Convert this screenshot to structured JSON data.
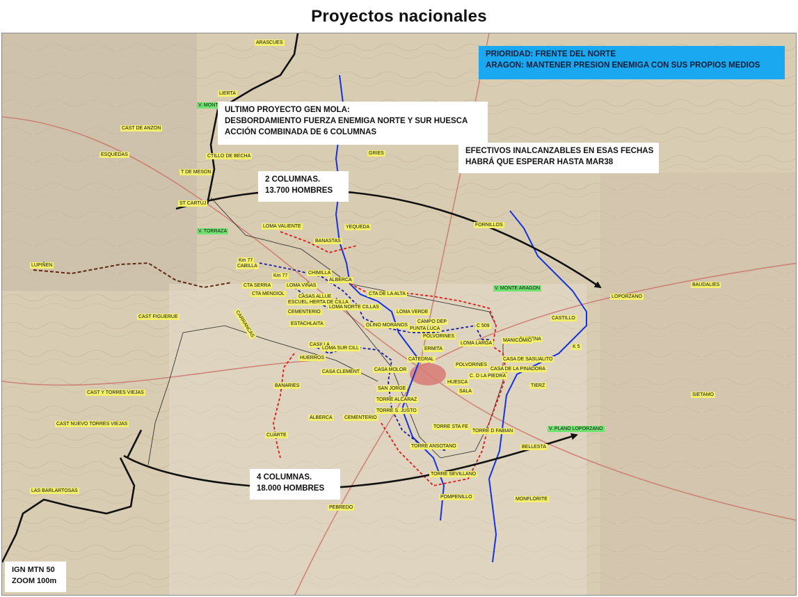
{
  "title": "Proyectos nacionales",
  "colors": {
    "map_base": "#d8ccb3",
    "front_line": "#111111",
    "river": "#1432e0",
    "red_dash": "#e01818",
    "blue_dash": "#1a1aa0",
    "brown_dash": "#5a2a10",
    "label_yellow": "#f4f06a",
    "label_green": "#72e372",
    "priority_box": "#1aa8f0"
  },
  "boxes": {
    "priority": [
      "PRIORIDAD: FRENTE DEL NORTE",
      "ARAGON: MANTENER PRESION ENEMIGA CON SUS PROPIOS MEDIOS"
    ],
    "mola": [
      "ULTIMO PROYECTO GEN MOLA:",
      "DESBORDAMIENTO FUERZA ENEMIGA NORTE Y SUR HUESCA",
      "ACCIÓN COMBINADA DE 6 COLUMNAS"
    ],
    "efectivos": [
      "EFECTIVOS INALCANZABLES EN ESAS FECHAS",
      "HABRÁ QUE ESPERAR HASTA MAR38"
    ],
    "col2": [
      "2 COLUMNAS.",
      "13.700 HOMBRES"
    ],
    "col4": [
      "4 COLUMNAS.",
      "18.000 HOMBRES"
    ],
    "source": [
      "IGN MTN 50",
      "ZOOM 100m"
    ]
  },
  "places": [
    {
      "t": "ARASCUES",
      "c": "y"
    },
    {
      "t": "LIERTA",
      "c": "y"
    },
    {
      "t": "V. MONT",
      "c": "g"
    },
    {
      "t": "CAST DE ANZON",
      "c": "y"
    },
    {
      "t": "ESQUEDAS",
      "c": "y"
    },
    {
      "t": "CTILLO DE BECHA",
      "c": "y"
    },
    {
      "t": "T DE MESON",
      "c": "y"
    },
    {
      "t": "ST CARTUJ",
      "c": "y"
    },
    {
      "t": "V. TORRAZA",
      "c": "g"
    },
    {
      "t": "LOMA VALIENTE",
      "c": "y"
    },
    {
      "t": "BANASTAS",
      "c": "y"
    },
    {
      "t": "YEQUEDA",
      "c": "y"
    },
    {
      "t": "GRIES",
      "c": "y"
    },
    {
      "t": "FORNILLOS",
      "c": "y"
    },
    {
      "t": "LUPIÑEN",
      "c": "y"
    },
    {
      "t": "Km 77",
      "c": "y"
    },
    {
      "t": "CABILLA",
      "c": "y"
    },
    {
      "t": "Km 77",
      "c": "y"
    },
    {
      "t": "CHIMILLA",
      "c": "y"
    },
    {
      "t": "ALBERCA",
      "c": "y"
    },
    {
      "t": "LOMA VIÑAS",
      "c": "y"
    },
    {
      "t": "CTA SERRA",
      "c": "y"
    },
    {
      "t": "CTA MENDIOL",
      "c": "y"
    },
    {
      "t": "CASAS ALLUE",
      "c": "y"
    },
    {
      "t": "ESCUELA",
      "c": "y"
    },
    {
      "t": "HERTA DE CILLA",
      "c": "y"
    },
    {
      "t": "LOMA NORTE CILLAS",
      "c": "y"
    },
    {
      "t": "CTA DE LA ALTA",
      "c": "y"
    },
    {
      "t": "V. MONTE ARAGON",
      "c": "g"
    },
    {
      "t": "LOPORZANO",
      "c": "y"
    },
    {
      "t": "BAUDALIES",
      "c": "y"
    },
    {
      "t": "CAST FIGUERUE",
      "c": "y"
    },
    {
      "t": "CEMENTERIO",
      "c": "y"
    },
    {
      "t": "ESTACHLAITA",
      "c": "y"
    },
    {
      "t": "LOMA VERDE",
      "c": "y"
    },
    {
      "t": "CAMPO DEP",
      "c": "y"
    },
    {
      "t": "OLINO MORANOS",
      "c": "y"
    },
    {
      "t": "PUNTA LUCA",
      "c": "y"
    },
    {
      "t": "C 509",
      "c": "y"
    },
    {
      "t": "CASTILLO",
      "c": "y"
    },
    {
      "t": "POLVORINES",
      "c": "y"
    },
    {
      "t": "QUICENA",
      "c": "y"
    },
    {
      "t": "K 5",
      "c": "y"
    },
    {
      "t": "LOMA LARGA",
      "c": "y"
    },
    {
      "t": "MANICOMIO",
      "c": "y"
    },
    {
      "t": "ERMITA",
      "c": "y"
    },
    {
      "t": "CASILLA",
      "c": "y"
    },
    {
      "t": "LOMA SUR CILL",
      "c": "y"
    },
    {
      "t": "HUERROS",
      "c": "y"
    },
    {
      "t": "CATEDRAL",
      "c": "y"
    },
    {
      "t": "CASA DE SASUALITO",
      "c": "y"
    },
    {
      "t": "POLVORINES",
      "c": "y"
    },
    {
      "t": "CASA DE LA PINADORA",
      "c": "y"
    },
    {
      "t": "C. D LA PIEDRA",
      "c": "y"
    },
    {
      "t": "CASA CLEMENT",
      "c": "y"
    },
    {
      "t": "CASA MOLOR",
      "c": "y"
    },
    {
      "t": "HUESCA",
      "c": "y"
    },
    {
      "t": "SALA",
      "c": "y"
    },
    {
      "t": "BANARIES",
      "c": "y"
    },
    {
      "t": "SAN JORGE",
      "c": "y"
    },
    {
      "t": "TORRE ALCARAZ",
      "c": "y"
    },
    {
      "t": "TORRE S. JUSTO",
      "c": "y"
    },
    {
      "t": "TIERZ",
      "c": "y"
    },
    {
      "t": "SIETAMO",
      "c": "y"
    },
    {
      "t": "CAST Y TORRES VIEJAS",
      "c": "y"
    },
    {
      "t": "CAST NUEVO TORRES VIEJAS",
      "c": "y"
    },
    {
      "t": "ALBERCA",
      "c": "y"
    },
    {
      "t": "CEMENTERIO",
      "c": "y"
    },
    {
      "t": "CUARTE",
      "c": "y"
    },
    {
      "t": "TORRE STA FE",
      "c": "y"
    },
    {
      "t": "TORRE D FABIAN",
      "c": "y"
    },
    {
      "t": "V. PLANO LOPORZANO",
      "c": "g"
    },
    {
      "t": "BELLESTA",
      "c": "y"
    },
    {
      "t": "TORRE ANSOTANO",
      "c": "y"
    },
    {
      "t": "TORRE SEVILLANO",
      "c": "y"
    },
    {
      "t": "LAS BARLARTOSAS",
      "c": "y"
    },
    {
      "t": "PEBREDO",
      "c": "y"
    },
    {
      "t": "POMPENILLO",
      "c": "y"
    },
    {
      "t": "MONFLORITE",
      "c": "y"
    },
    {
      "t": "CARRANCAS",
      "c": "y"
    }
  ]
}
